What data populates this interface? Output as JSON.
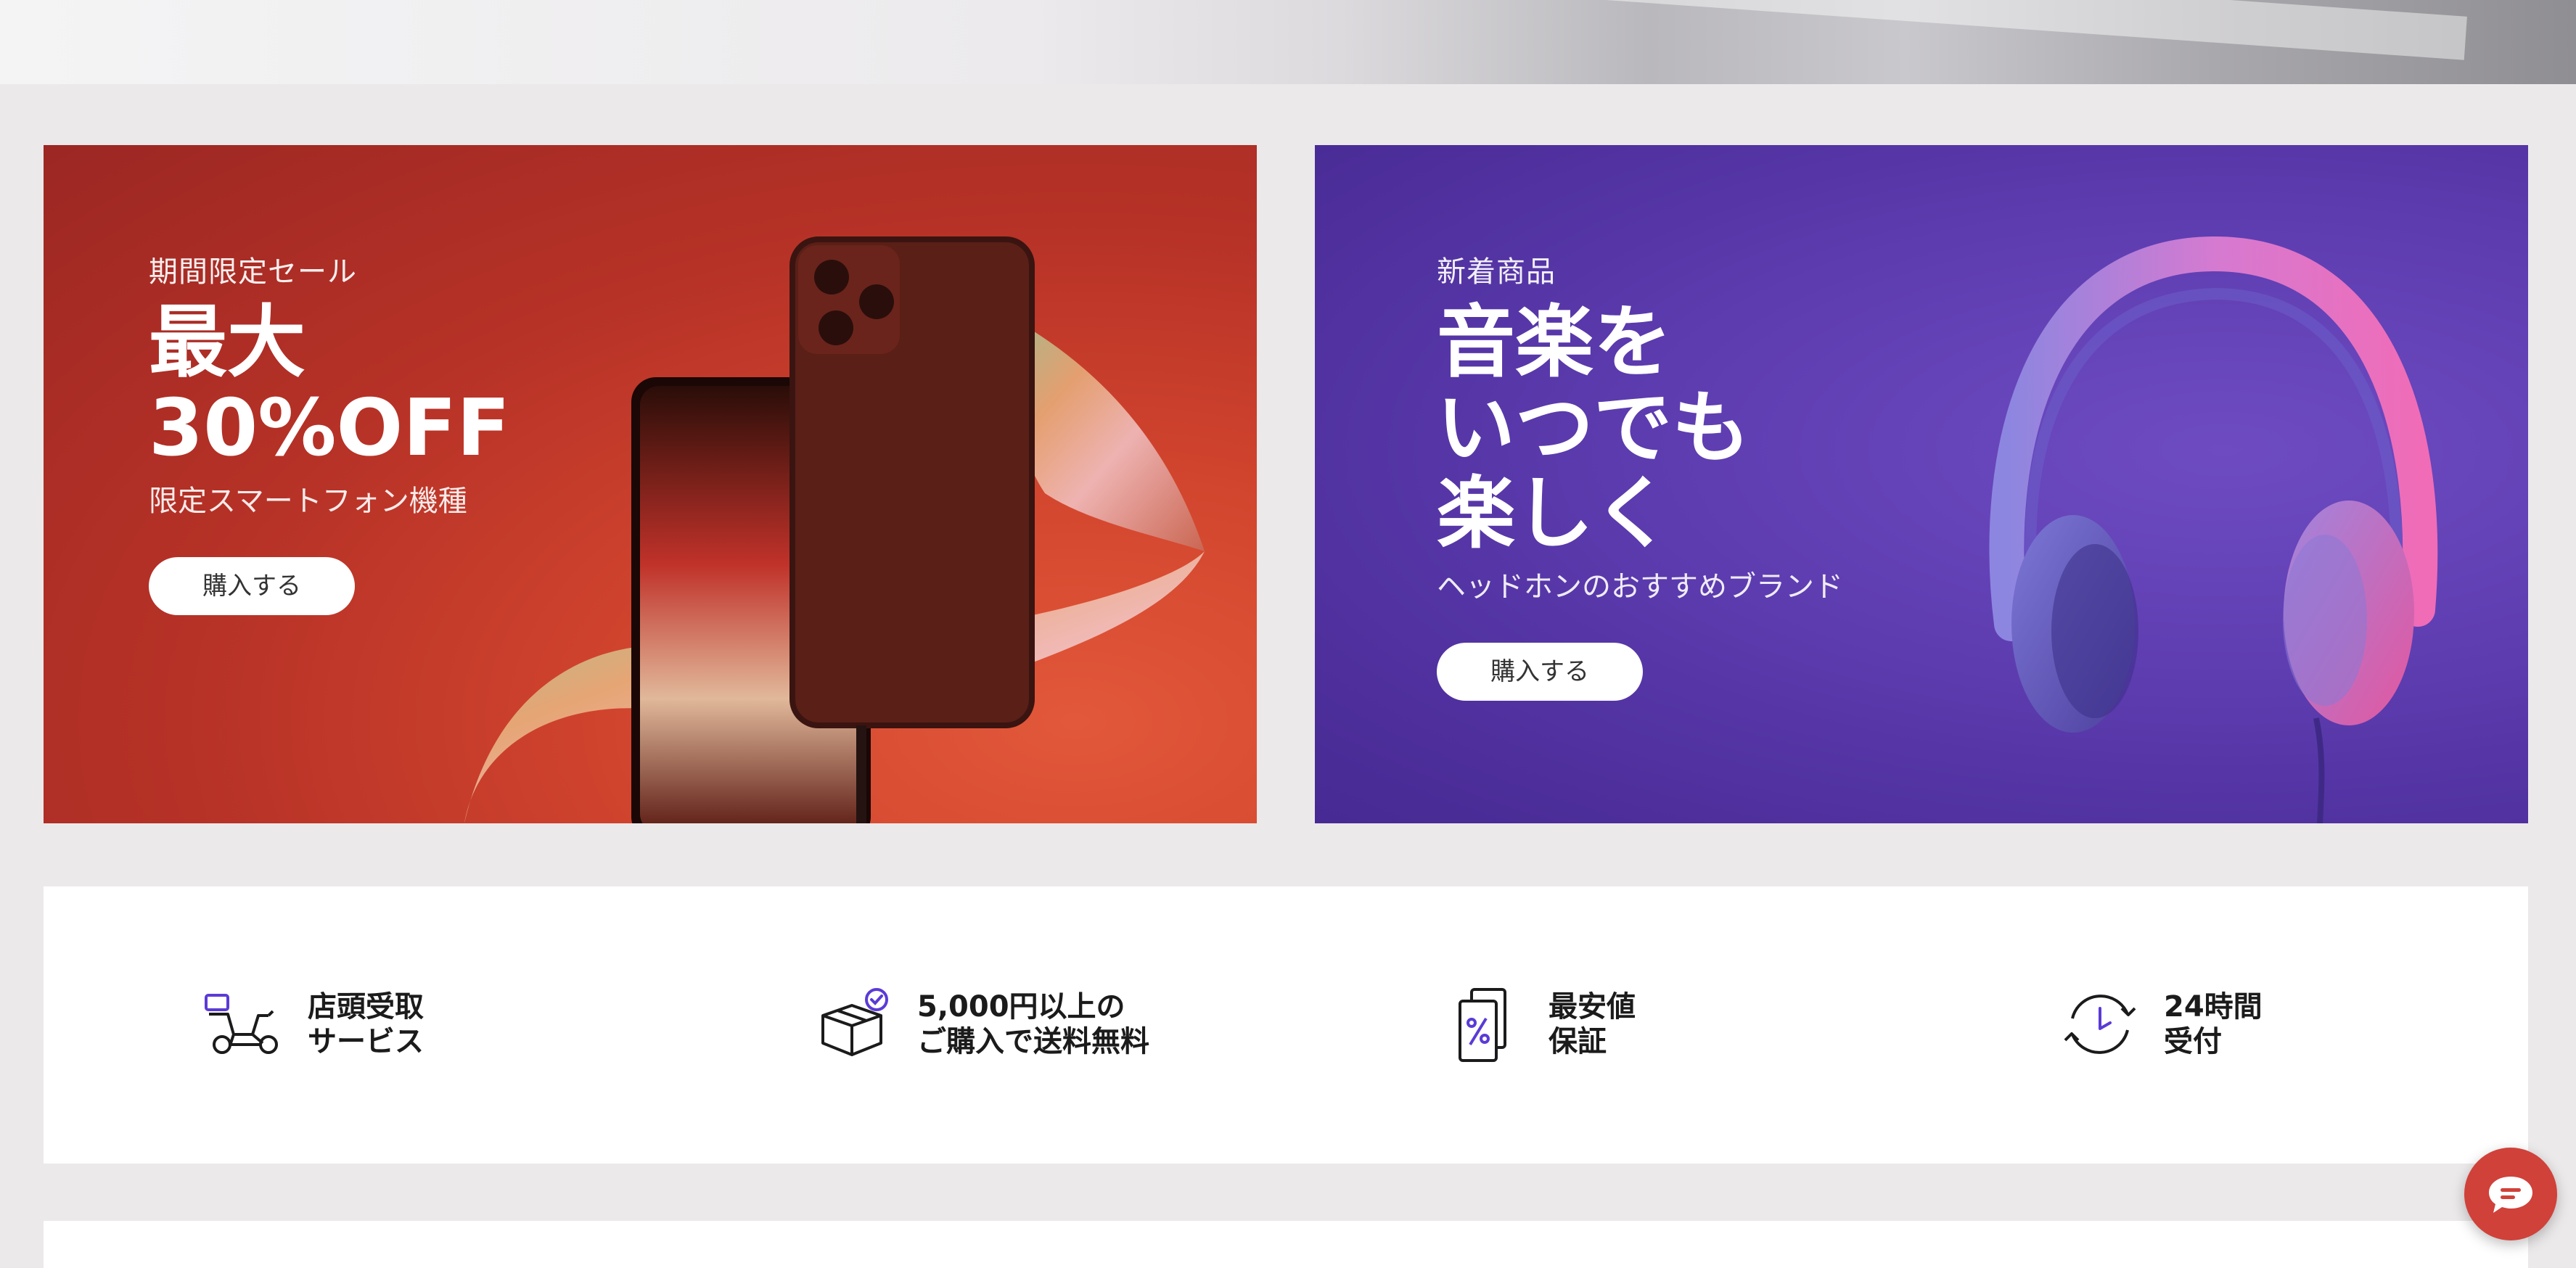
{
  "banners": [
    {
      "eyebrow": "期間限定セール",
      "headline": "最大\n30%OFF",
      "subline": "限定スマートフォン機種",
      "button": "購入する"
    },
    {
      "eyebrow": "新着商品",
      "headline": "音楽を\nいつでも\n楽しく",
      "subline": "ヘッドホンのおすすめブランド",
      "button": "購入する"
    }
  ],
  "features": [
    {
      "label": "店頭受取\nサービス",
      "icon": "scooter-icon"
    },
    {
      "label": "5,000円以上の\nご購入で送料無料",
      "icon": "box-check-icon"
    },
    {
      "label": "最安値\n保証",
      "icon": "percent-tag-icon"
    },
    {
      "label": "24時間\n受付",
      "icon": "clock-refresh-icon"
    }
  ],
  "chat": {
    "icon": "chat-bubble-icon"
  },
  "colors": {
    "red_banner": "#B73227",
    "purple_banner": "#5F3EB2",
    "accent": "#5B3BD6",
    "chat_button": "#D0413A"
  }
}
